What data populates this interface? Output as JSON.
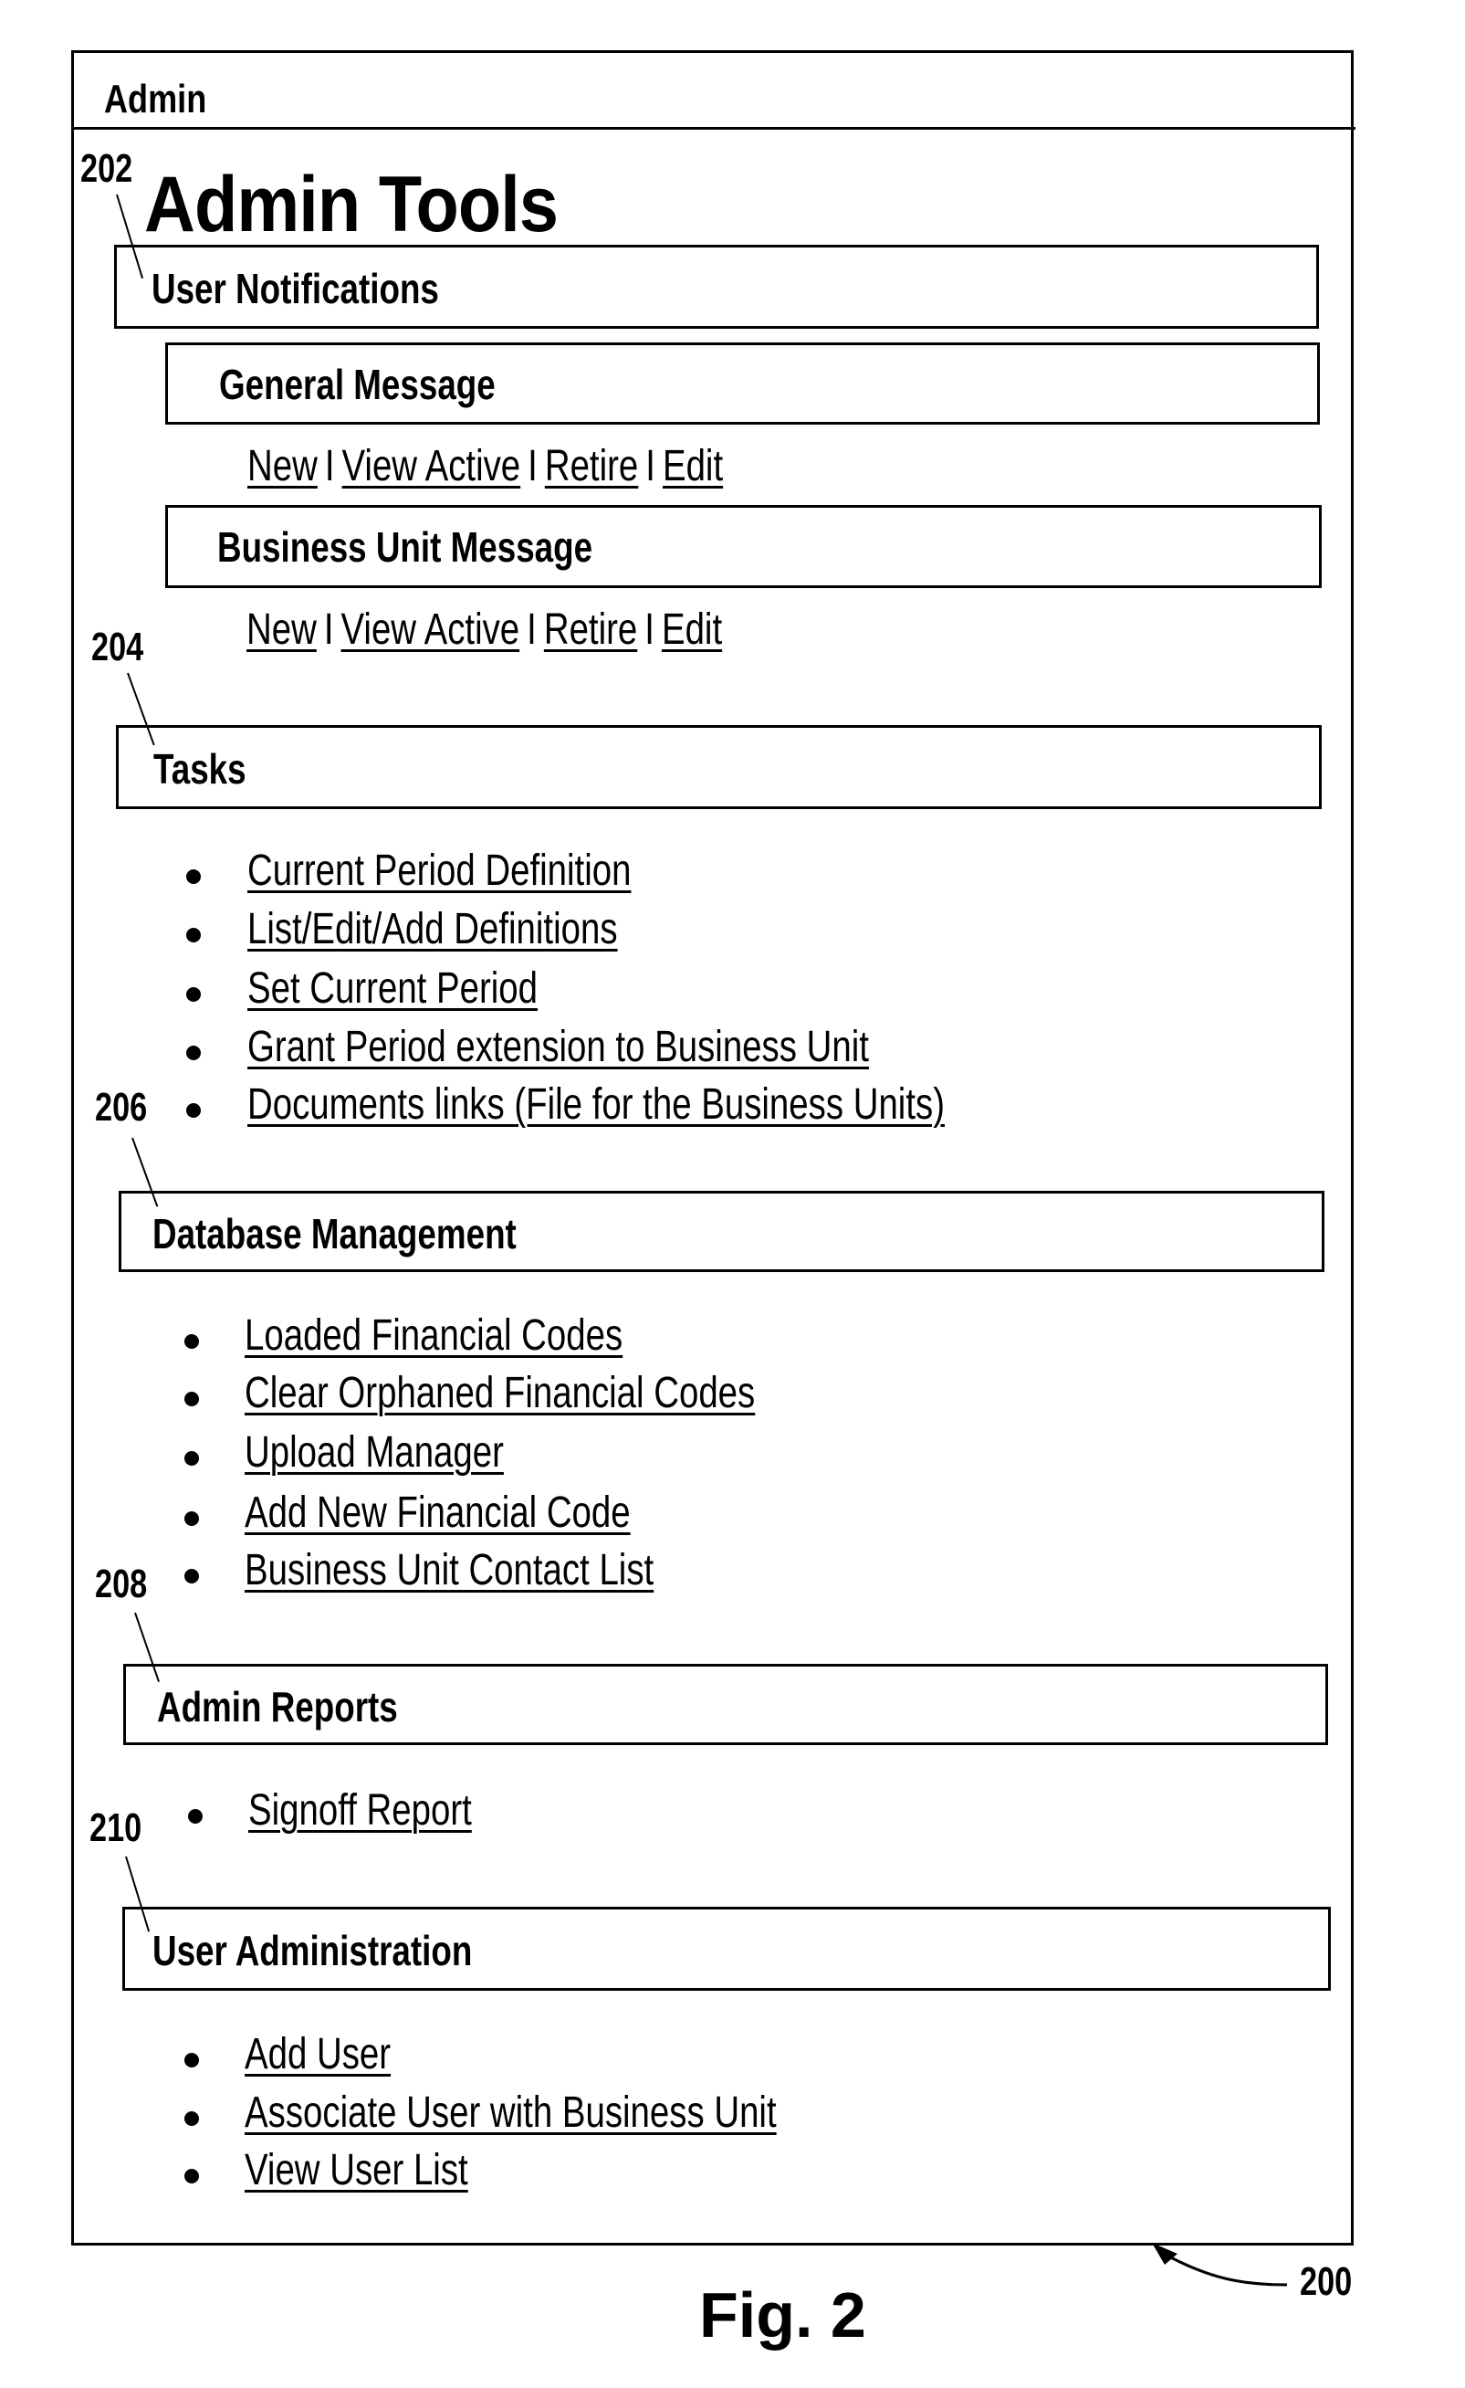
{
  "figure": {
    "caption": "Fig. 2",
    "reference": "200"
  },
  "window": {
    "title": "Admin"
  },
  "page": {
    "title": "Admin Tools",
    "title_ref": "202"
  },
  "sections": {
    "user_notifications": {
      "label": "User Notifications",
      "general_message": {
        "label": "General Message",
        "links": [
          "New",
          "View Active",
          "Retire",
          "Edit"
        ]
      },
      "business_unit_message": {
        "label": "Business Unit Message",
        "links": [
          "New",
          "View Active",
          "Retire",
          "Edit"
        ]
      },
      "separator": "I"
    },
    "tasks": {
      "label": "Tasks",
      "ref": "204",
      "items": [
        "Current Period Definition",
        "List/Edit/Add Definitions",
        "Set Current Period",
        "Grant Period extension to Business Unit",
        "Documents links (File for the Business Units)"
      ]
    },
    "database_management": {
      "label": "Database Management",
      "ref": "206",
      "items": [
        "Loaded Financial Codes",
        "Clear Orphaned Financial Codes",
        "Upload Manager",
        "Add New Financial Code",
        "Business Unit Contact List"
      ]
    },
    "admin_reports": {
      "label": "Admin Reports",
      "ref": "208",
      "items": [
        "Signoff Report"
      ]
    },
    "user_administration": {
      "label": "User Administration",
      "ref": "210",
      "items": [
        "Add User",
        "Associate User with Business Unit",
        "View User List"
      ]
    }
  }
}
